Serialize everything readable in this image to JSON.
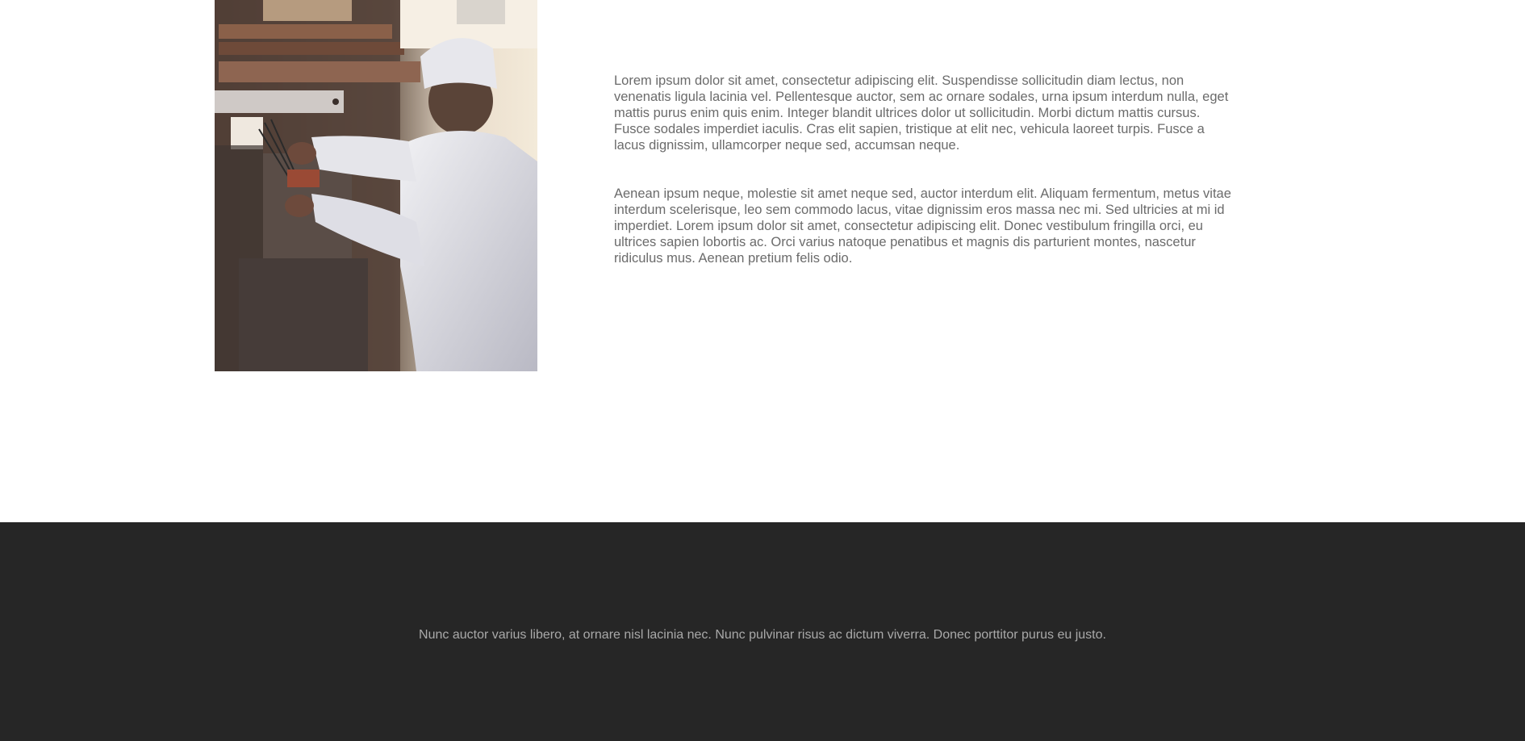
{
  "content": {
    "image": {
      "alt": "Chef in white uniform and hat working at a wooden cabinet"
    },
    "paragraphs": [
      "Lorem ipsum dolor sit amet, consectetur adipiscing elit. Suspendisse sollicitudin diam lectus, non venenatis ligula lacinia vel. Pellentesque auctor, sem ac ornare sodales, urna ipsum interdum nulla, eget mattis purus enim quis enim. Integer blandit ultrices dolor ut sollicitudin. Morbi dictum mattis cursus. Fusce sodales imperdiet iaculis. Cras elit sapien, tristique at elit nec, vehicula laoreet turpis. Fusce a lacus dignissim, ullamcorper neque sed, accumsan neque.",
      "Aenean ipsum neque, molestie sit amet neque sed, auctor interdum elit. Aliquam fermentum, metus vitae interdum scelerisque, leo sem commodo lacus, vitae dignissim eros massa nec mi. Sed ultricies at mi id imperdiet. Lorem ipsum dolor sit amet, consectetur adipiscing elit. Donec vestibulum fringilla orci, eu ultrices sapien lobortis ac. Orci varius natoque penatibus et magnis dis parturient montes, nascetur ridiculus mus. Aenean pretium felis odio."
    ]
  },
  "footer": {
    "text": "Nunc auctor varius libero, at ornare nisl lacinia nec. Nunc pulvinar risus ac dictum viverra. Donec porttitor purus eu justo."
  },
  "colors": {
    "background": "#ffffff",
    "body_text": "#6b6b6b",
    "footer_background": "#262626",
    "footer_text": "#a9a9a9"
  }
}
